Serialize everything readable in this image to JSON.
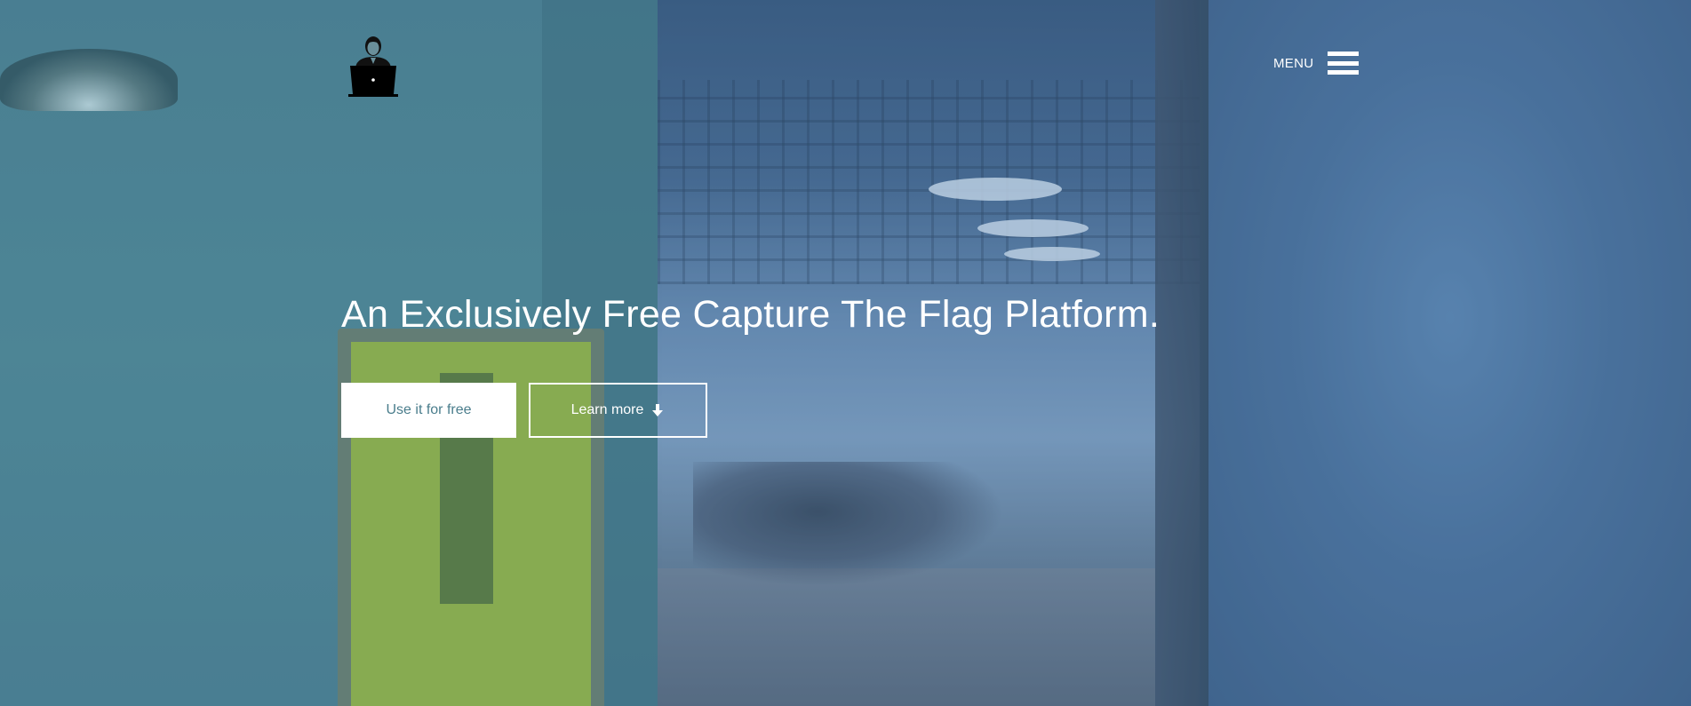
{
  "header": {
    "logo_icon": "hacker-laptop-icon",
    "menu_label": "MENU",
    "menu_icon": "hamburger-icon"
  },
  "hero": {
    "headline": "An Exclusively Free Capture The Flag Platform.",
    "primary_button_label": "Use it for free",
    "secondary_button_label": "Learn more",
    "secondary_button_icon": "arrow-down-icon"
  },
  "colors": {
    "primary_button_text": "#4a7d8c",
    "overlay_tint": "#4a7d8c",
    "text": "#ffffff"
  }
}
